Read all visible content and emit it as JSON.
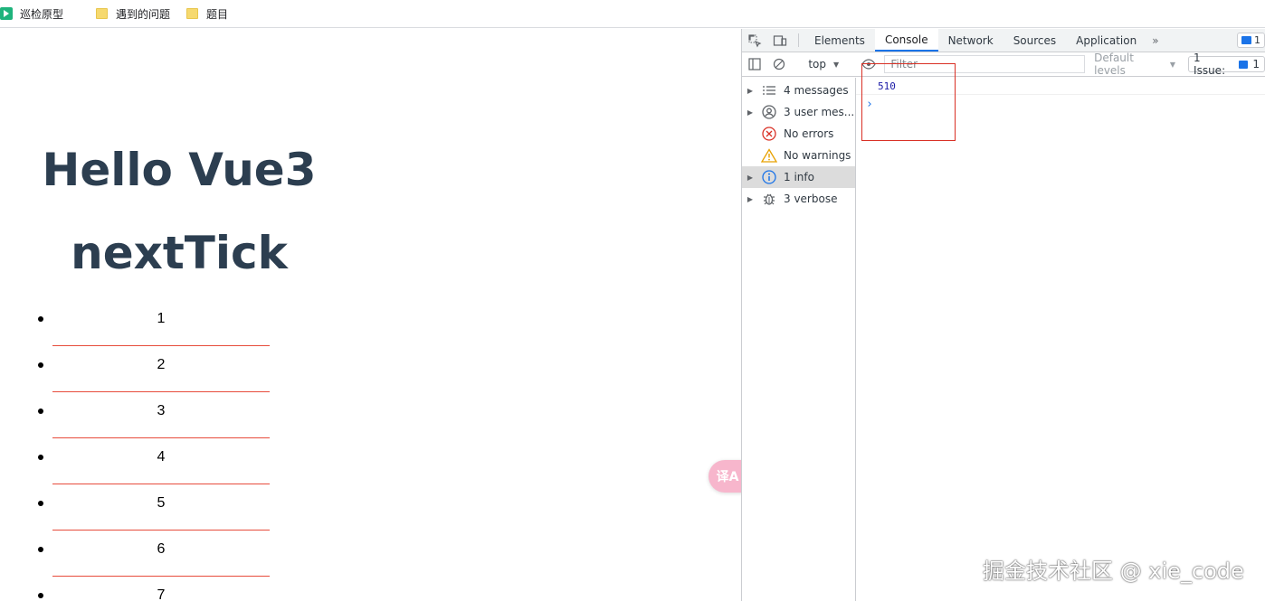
{
  "bookmarks": [
    {
      "label": "巡检原型",
      "icon": "play-icon"
    },
    {
      "label": "遇到的问题",
      "icon": "folder-icon"
    },
    {
      "label": "题目",
      "icon": "folder-icon"
    }
  ],
  "page": {
    "title_line1": "Hello Vue3",
    "title_line2": "nextTick",
    "items": [
      "1",
      "2",
      "3",
      "4",
      "5",
      "6",
      "7"
    ],
    "translate_button": "译A"
  },
  "devtools": {
    "tabs": [
      "Elements",
      "Console",
      "Network",
      "Sources",
      "Application"
    ],
    "active_tab": "Console",
    "more_tabs": "»",
    "issue_badge_count": "1",
    "context": "top",
    "filter_placeholder": "Filter",
    "levels": "Default levels",
    "issues_button": "1 Issue:",
    "issues_count": "1",
    "sidebar": [
      {
        "label": "4 messages",
        "icon": "list-icon",
        "expandable": true
      },
      {
        "label": "3 user mes...",
        "icon": "user-icon",
        "expandable": true
      },
      {
        "label": "No errors",
        "icon": "error-icon",
        "expandable": false
      },
      {
        "label": "No warnings",
        "icon": "warning-icon",
        "expandable": false
      },
      {
        "label": "1 info",
        "icon": "info-icon",
        "expandable": true
      },
      {
        "label": "3 verbose",
        "icon": "bug-icon",
        "expandable": true
      }
    ],
    "console_output": "510",
    "prompt_symbol": "›"
  },
  "watermark": "掘金技术社区 @ xie_code",
  "colors": {
    "accent": "#1a73e8",
    "heading": "#2c3e50",
    "divider": "#e74c3c",
    "highlight_box": "#d93025"
  }
}
